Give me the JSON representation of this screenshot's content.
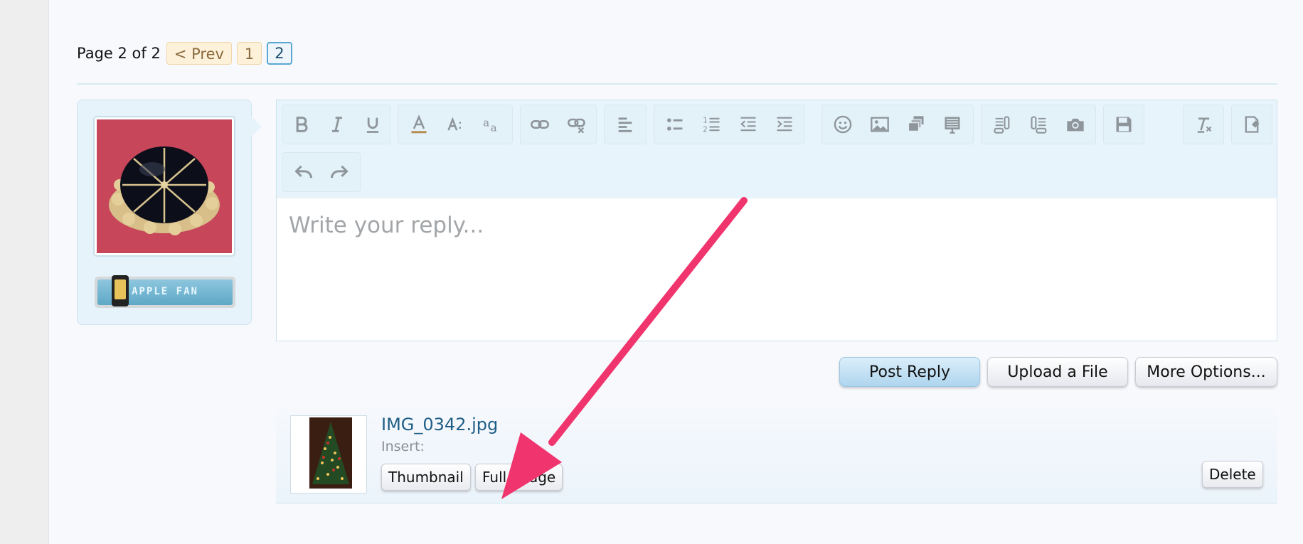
{
  "pagination": {
    "info": "Page 2 of 2",
    "prev_label": "< Prev",
    "pages": [
      "1",
      "2"
    ],
    "current_page": "2"
  },
  "user": {
    "badge_text": "APPLE FAN"
  },
  "editor": {
    "placeholder": "Write your reply...",
    "toolbar_icons": [
      "bold-icon",
      "italic-icon",
      "underline-icon",
      "text-color-icon",
      "font-size-icon",
      "font-family-icon",
      "link-icon",
      "unlink-icon",
      "align-left-icon",
      "bullet-list-icon",
      "numbered-list-icon",
      "outdent-icon",
      "indent-icon",
      "smilie-icon",
      "image-icon",
      "media-icon",
      "quote-icon",
      "code-icon",
      "php-icon",
      "screenshot-icon",
      "save-draft-icon",
      "remove-format-icon",
      "bbcode-toggle-icon",
      "undo-icon",
      "redo-icon"
    ]
  },
  "actions": {
    "post_reply": "Post Reply",
    "upload_file": "Upload a File",
    "more_options": "More Options..."
  },
  "attachment": {
    "file_name": "IMG_0342.jpg",
    "insert_label": "Insert:",
    "thumbnail_label": "Thumbnail",
    "full_image_label": "Full Image",
    "delete_label": "Delete"
  },
  "colors": {
    "accent": "#5aa8d2",
    "link": "#1f5e86",
    "arrow": "#f0356e"
  }
}
